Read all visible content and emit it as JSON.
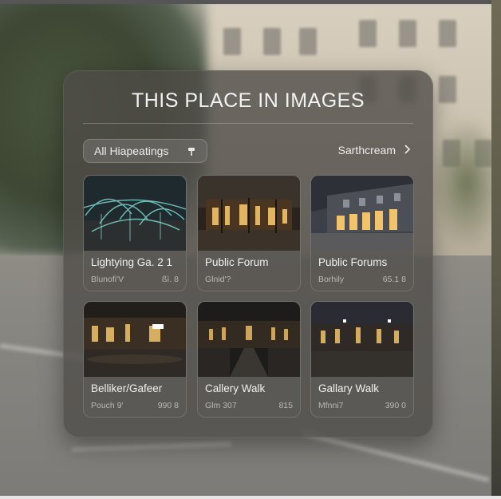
{
  "panel": {
    "title": "THIS PLACE IN IMAGES",
    "filter_label": "All Hiapeatings",
    "search_label": "Sarthcream"
  },
  "icons": {
    "filter": "pin-icon",
    "search": "chevron-right-icon"
  },
  "cards": [
    {
      "title": "Lightying Ga. 2 1",
      "subtitle": "Blunofi'V",
      "meta": "ßì. 8",
      "scene": "light-installation"
    },
    {
      "title": "Public Forum",
      "subtitle": "Glnid'?",
      "meta": "",
      "scene": "night-courtyard"
    },
    {
      "title": "Public Forums",
      "subtitle": "Borhily",
      "meta": "65.1 8",
      "scene": "night-storefront"
    },
    {
      "title": "Belliker/Gafeer",
      "subtitle": "Pouch 9'",
      "meta": "990 8",
      "scene": "night-plaza"
    },
    {
      "title": "Callery Walk",
      "subtitle": "Glm 307",
      "meta": "815",
      "scene": "night-arcade"
    },
    {
      "title": "Gallary Walk",
      "subtitle": "Mfnni7",
      "meta": "390 0",
      "scene": "night-gallery"
    }
  ],
  "colors": {
    "panel_bg": "#4e4c48",
    "text": "#f2f2f2",
    "subtext": "#b9b7b2",
    "warm_light": "#f3c36a",
    "cyan_light": "#7fd6d0"
  }
}
